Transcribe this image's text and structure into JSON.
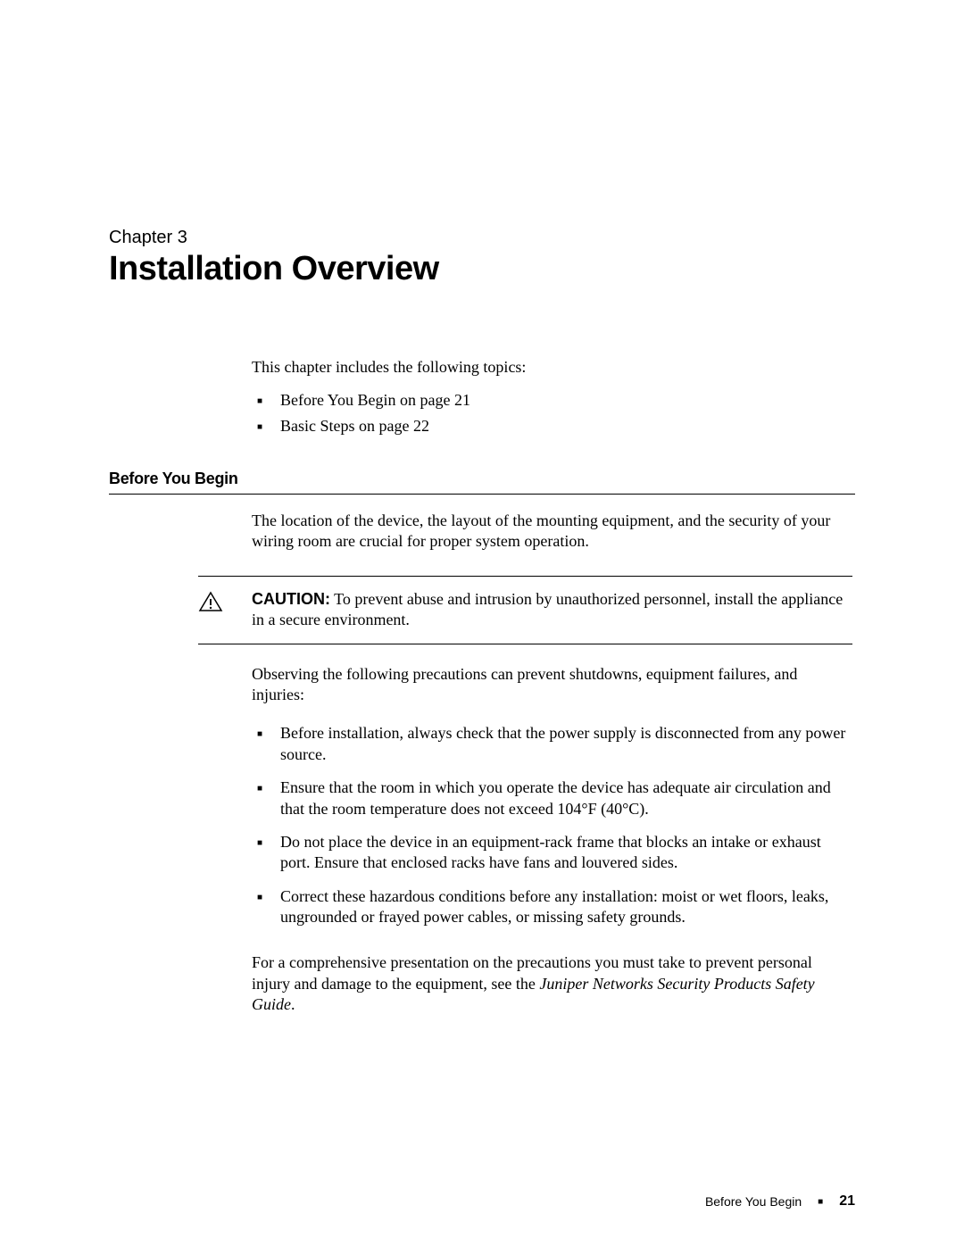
{
  "chapter": {
    "label": "Chapter 3",
    "title": "Installation Overview"
  },
  "intro": {
    "text": "This chapter includes the following topics:",
    "topics": [
      "Before You Begin on page 21",
      "Basic Steps on page 22"
    ]
  },
  "section": {
    "title": "Before You Begin",
    "location_text": "The location of the device, the layout of the mounting equipment, and the security of your wiring room are crucial for proper system operation."
  },
  "caution": {
    "label": "CAUTION:",
    "text": " To prevent abuse and intrusion by unauthorized personnel, install the appliance in a secure environment."
  },
  "precautions": {
    "intro": "Observing the following precautions can prevent shutdowns, equipment failures, and injuries:",
    "items": [
      "Before installation, always check that the power supply is disconnected from any power source.",
      "Ensure that the room in which you operate the device has adequate air circulation and that the room temperature does not exceed 104°F (40°C).",
      "Do not place the device in an equipment-rack frame that blocks an intake or exhaust port. Ensure that enclosed racks have fans and louvered sides.",
      "Correct these hazardous conditions before any installation: moist or wet floors, leaks, ungrounded or frayed power cables, or missing safety grounds."
    ]
  },
  "closing": {
    "text_before": "For a comprehensive presentation on the precautions you must take to prevent personal injury and damage to the equipment, see the ",
    "italic_text": "Juniper Networks Security Products Safety Guide",
    "text_after": "."
  },
  "footer": {
    "section": "Before You Begin",
    "page": "21"
  }
}
